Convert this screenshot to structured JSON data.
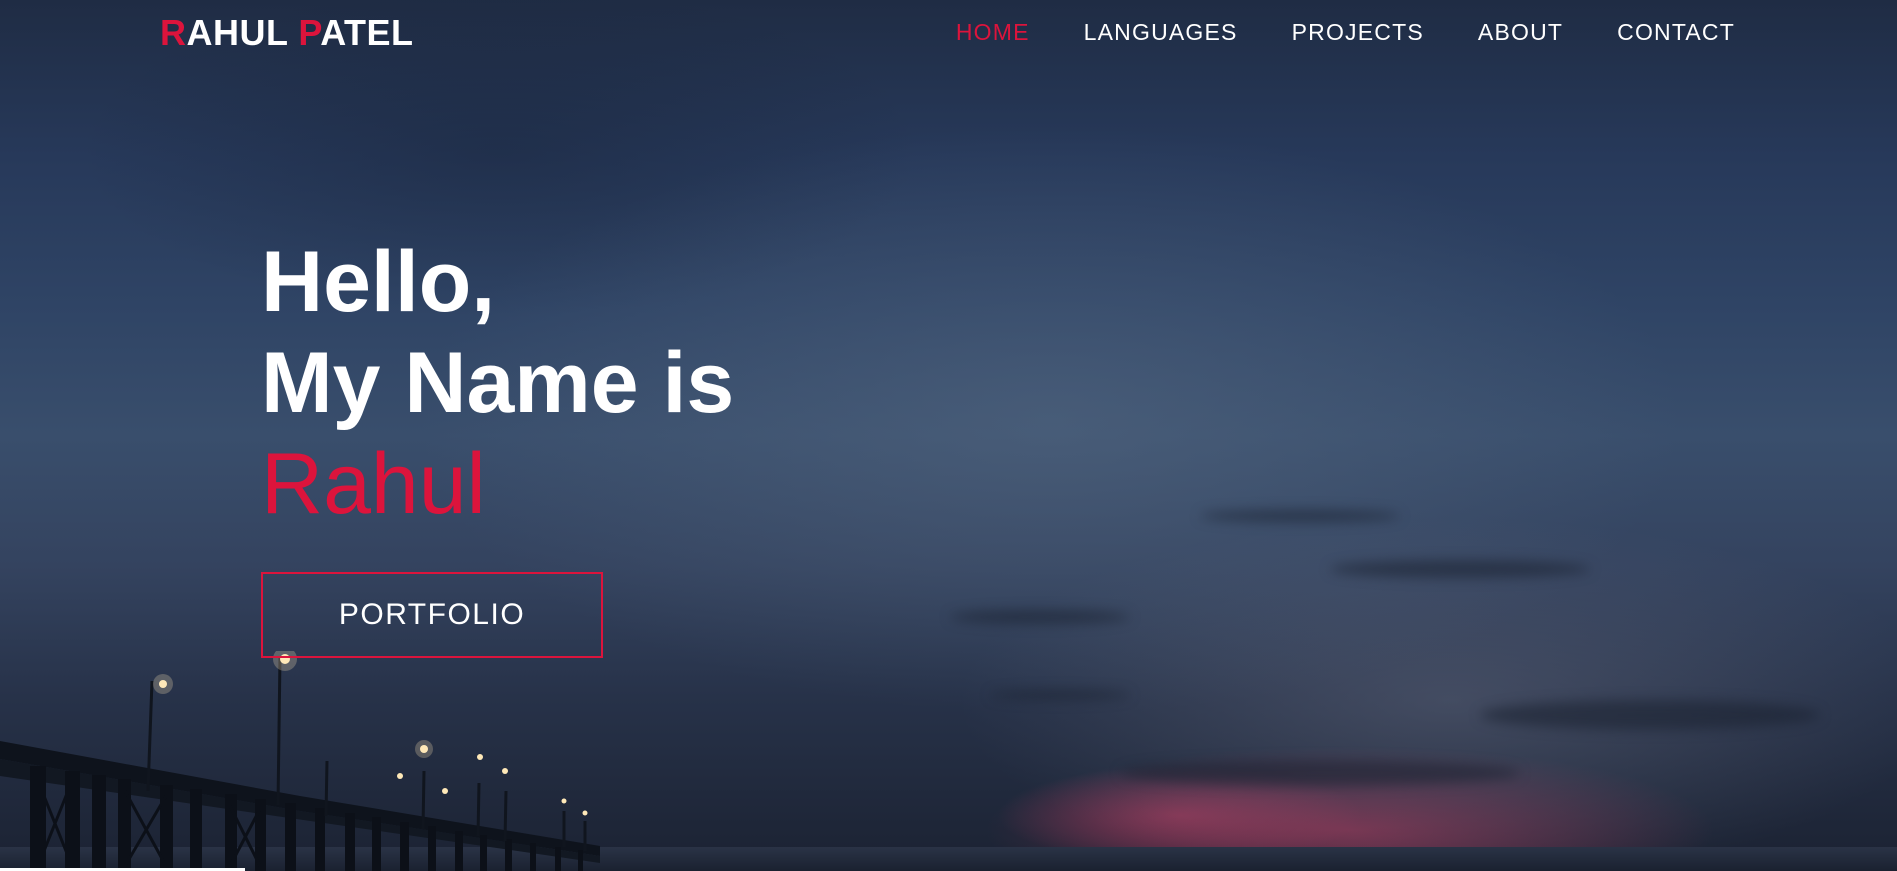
{
  "nav": {
    "brand": {
      "first_initial": "R",
      "first_rest": "AHUL",
      "last_initial": "P",
      "last_rest": "ATEL"
    },
    "links": [
      {
        "label": "HOME",
        "active": true
      },
      {
        "label": "LANGUAGES",
        "active": false
      },
      {
        "label": "PROJECTS",
        "active": false
      },
      {
        "label": "ABOUT",
        "active": false
      },
      {
        "label": "CONTACT",
        "active": false
      }
    ]
  },
  "hero": {
    "line1": "Hello,",
    "line2": "My Name is",
    "name": "Rahul",
    "button_label": "PORTFOLIO"
  },
  "colors": {
    "accent": "#dc143c",
    "text": "#ffffff",
    "sky": "#2f4465"
  }
}
